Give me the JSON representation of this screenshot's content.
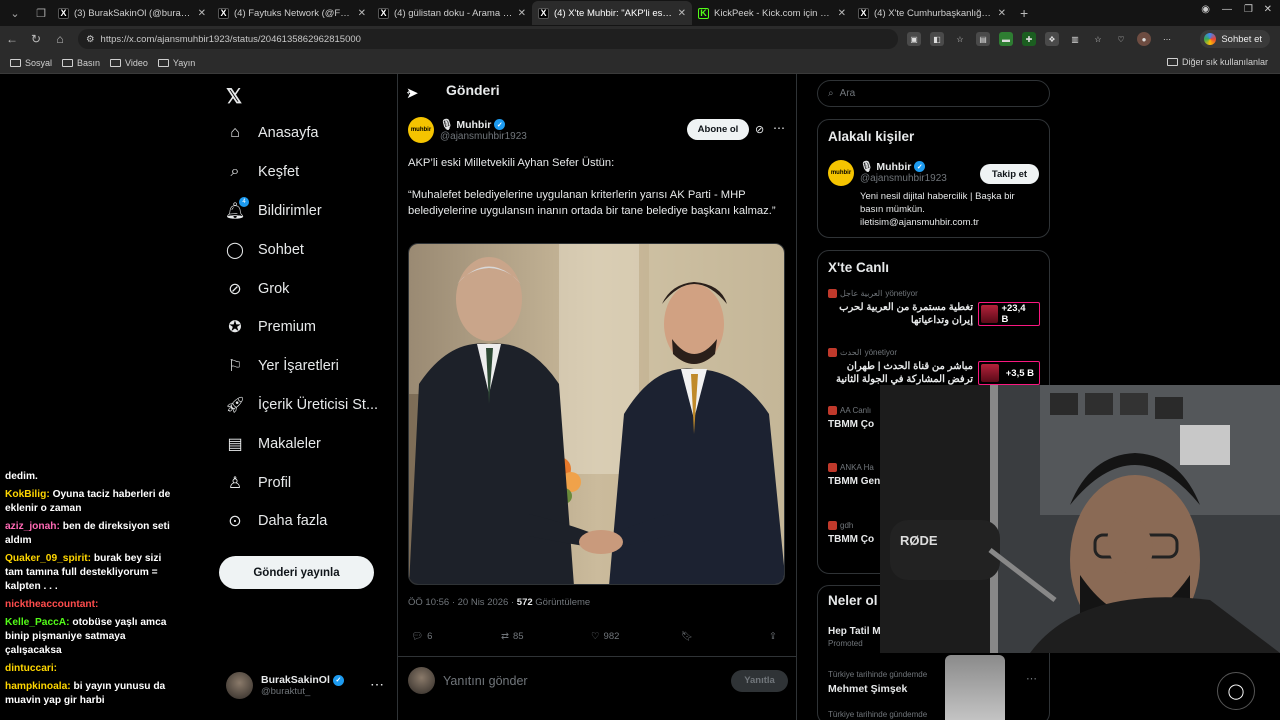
{
  "browser": {
    "tabs": [
      {
        "label": "(3) BurakSakinOl (@buraktut_) / X",
        "icon": "x-logo-icon",
        "active": false
      },
      {
        "label": "(4) Faytuks Network (@FaytuksNetwork) / X",
        "icon": "x-logo-icon",
        "active": false
      },
      {
        "label": "(4) gülistan doku - Arama / X",
        "icon": "x-logo-icon",
        "active": false
      },
      {
        "label": "(4) X'te Muhbir: \"AKP'li eski Milletvekili",
        "icon": "x-logo-icon",
        "active": true
      },
      {
        "label": "KickPeek - Kick.com için Gerçek Za...",
        "icon": "kick-icon",
        "active": false
      },
      {
        "label": "(4) X'te Cumhurbaşkanlığı Aday Of...",
        "icon": "x-logo-icon",
        "active": false
      }
    ],
    "url": "https://x.com/ajansmuhbir1923/status/2046135862962815000",
    "chat_button": "Sohbet et",
    "bookmarks": [
      "Sosyal",
      "Basın",
      "Video",
      "Yayın"
    ],
    "bookmarks_right": "Diğer sık kullanılanlar"
  },
  "chat": [
    {
      "user": "",
      "text": "dedim.",
      "color": "#ffffff"
    },
    {
      "user": "KokBilig:",
      "text": "Oyuna taciz haberleri de eklenir o zaman",
      "color": "#ffd700"
    },
    {
      "user": "aziz_jonah:",
      "text": "ben de direksiyon seti aldım",
      "color": "#ff69b4"
    },
    {
      "user": "Quaker_09_spirit:",
      "text": "burak bey sizi tam tamına full destekliyorum = kalpten . . .",
      "color": "#ffd700"
    },
    {
      "user": "nicktheaccountant:",
      "text": "",
      "color": "#ff4d4d"
    },
    {
      "user": "Kelle_PaccA:",
      "text": "otobüse yaşlı amca binip pişmaniye satmaya çalışacaksa",
      "color": "#53fc18"
    },
    {
      "user": "dintuccari:",
      "text": "",
      "color": "#ffd700"
    },
    {
      "user": "hampkinoala:",
      "text": "bi yayın yunusu da muavin yap gir harbi",
      "color": "#ffd700"
    }
  ],
  "nav": {
    "items": [
      {
        "label": "Anasayfa",
        "icon": "home-icon"
      },
      {
        "label": "Keşfet",
        "icon": "search-icon"
      },
      {
        "label": "Bildirimler",
        "icon": "bell-icon",
        "badge": "4"
      },
      {
        "label": "Sohbet",
        "icon": "chat-icon"
      },
      {
        "label": "Grok",
        "icon": "grok-icon"
      },
      {
        "label": "Premium",
        "icon": "premium-icon"
      },
      {
        "label": "Yer İşaretleri",
        "icon": "bookmark-icon"
      },
      {
        "label": "İçerik Üreticisi St...",
        "icon": "rocket-icon"
      },
      {
        "label": "Makaleler",
        "icon": "article-icon"
      },
      {
        "label": "Profil",
        "icon": "person-icon"
      },
      {
        "label": "Daha fazla",
        "icon": "more-circle-icon"
      }
    ],
    "post_button": "Gönderi yayınla",
    "account": {
      "name": "BurakSakinOl",
      "handle": "@buraktut_"
    }
  },
  "post": {
    "header": "Gönderi",
    "author_name": "Muhbir",
    "author_handle": "@ajansmuhbir1923",
    "author_logo_text": "muhbir",
    "subscribe": "Abone ol",
    "line1": "AKP’li eski Milletvekili Ayhan Sefer Üstün:",
    "line2": "“Muhalefet belediyelerine uygulanan kriterlerin yarısı AK Parti - MHP belediyelerine uygulansın inanın ortada bir tane belediye başkanı kalmaz.”",
    "time": "ÖÖ 10:56 · 20 Nis 2026 · ",
    "views": "572",
    "views_label": " Görüntüleme",
    "replies": "6",
    "reposts": "85",
    "likes": "982",
    "reply_placeholder": "Yanıtını gönder",
    "reply_button": "Yanıtla"
  },
  "right": {
    "search_placeholder": "Ara",
    "related_title": "Alakalı kişiler",
    "related_name": "Muhbir",
    "related_handle": "@ajansmuhbir1923",
    "follow": "Takip et",
    "bio": "Yeni nesil dijital habercilik | Başka bir basın mümkün. iletisim@ajansmuhbir.com.tr",
    "live_title": "X'te Canlı",
    "live": [
      {
        "source": "العربية عاجل",
        "host": "yönetiyor",
        "title": "تغطية مستمرة من العربية لحرب إيران وتداعياتها",
        "count": "+23,4 B"
      },
      {
        "source": "الحدث",
        "host": "yönetiyor",
        "title": "مباشر من قناة الحدث | طهران ترفض المشاركة في الجولة الثانية من",
        "count": "+3,5 B"
      },
      {
        "source": "AA Canlı",
        "host": "",
        "title": "TBMM Ço",
        "count": ""
      },
      {
        "source": "ANKA Ha",
        "host": "",
        "title": "TBMM Gen Çocuk Öze",
        "count": ""
      },
      {
        "source": "gdh",
        "host": "",
        "title": "TBMM Ço",
        "count": ""
      }
    ],
    "trends_title": "Neler ol",
    "trend1_name": "Hep Tatil M",
    "trend1_meta": "Promoted",
    "trend2_head": "Türkiye tarihinde gündemde",
    "trend2_name": "Mehmet Şimşek",
    "trend3_head": "Türkiye tarihinde gündemde"
  }
}
